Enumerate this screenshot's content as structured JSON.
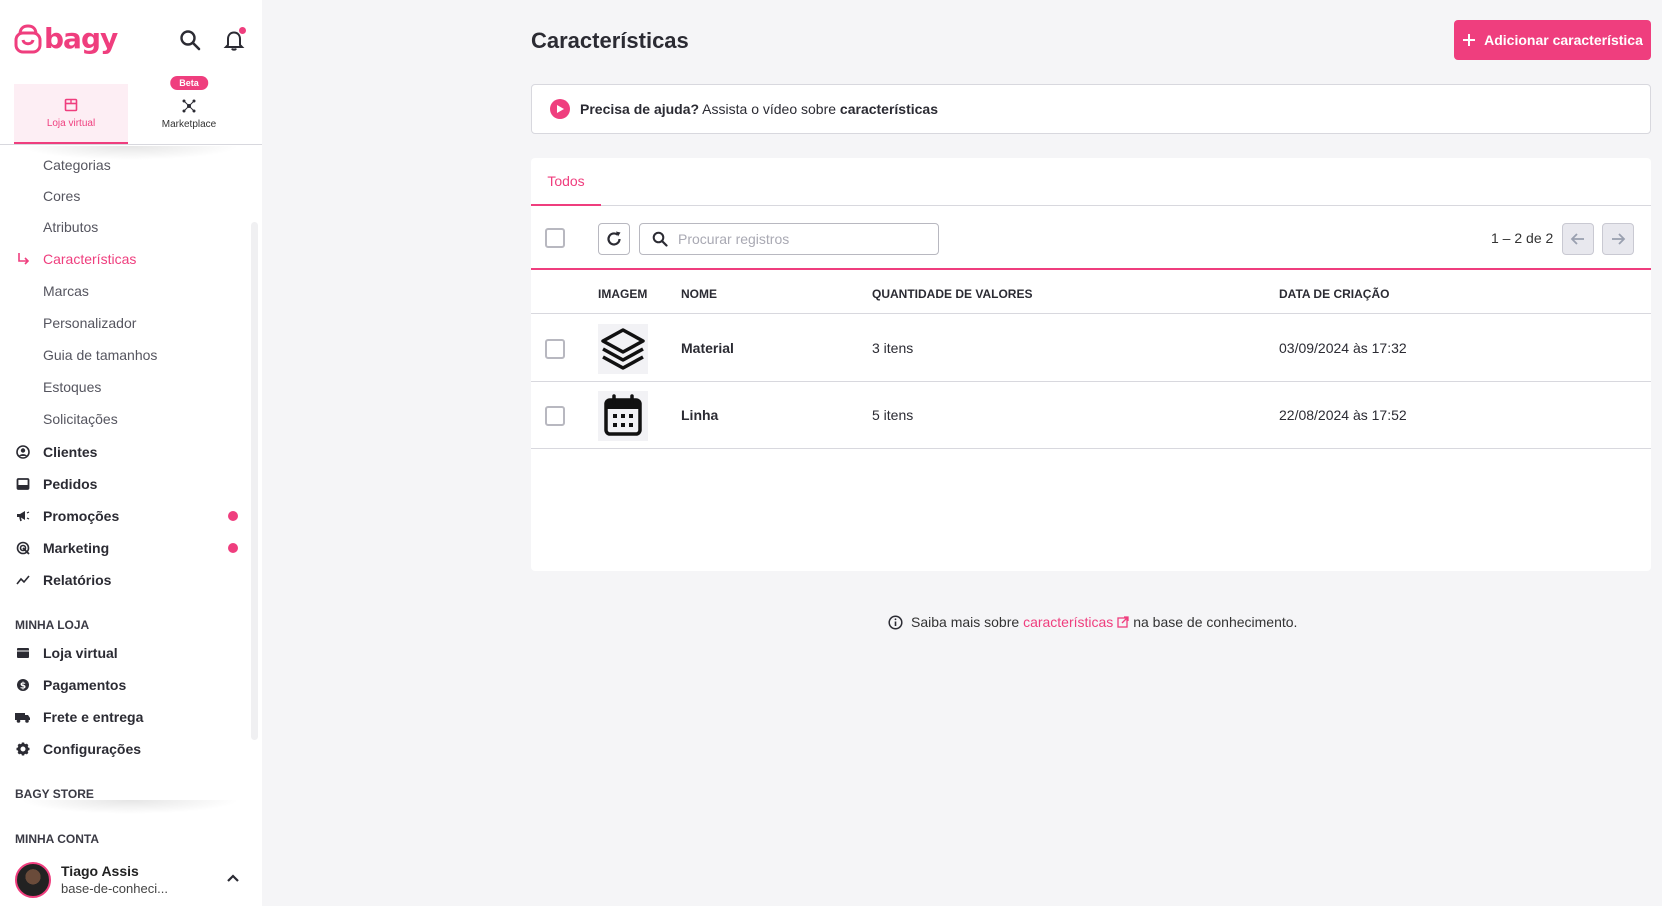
{
  "brand": {
    "name": "bagy",
    "accent": "#ef3e7e"
  },
  "context_tabs": [
    {
      "label": "Loja virtual",
      "icon": "store-icon",
      "active": true
    },
    {
      "label": "Marketplace",
      "icon": "network-icon",
      "badge": "Beta",
      "active": false
    }
  ],
  "nav": {
    "sub_items": [
      "Categorias",
      "Cores",
      "Atributos",
      "Características",
      "Marcas",
      "Personalizador",
      "Guia de tamanhos",
      "Estoques",
      "Solicitações"
    ],
    "current": "Características",
    "main_items": [
      {
        "label": "Clientes",
        "icon": "user-circle-icon"
      },
      {
        "label": "Pedidos",
        "icon": "inbox-icon"
      },
      {
        "label": "Promoções",
        "icon": "megaphone-icon",
        "dot": true
      },
      {
        "label": "Marketing",
        "icon": "target-icon",
        "dot": true
      },
      {
        "label": "Relatórios",
        "icon": "chart-line-icon"
      }
    ],
    "section_store": "MINHA LOJA",
    "store_items": [
      {
        "label": "Loja virtual",
        "icon": "storefront-icon"
      },
      {
        "label": "Pagamentos",
        "icon": "dollar-circle-icon"
      },
      {
        "label": "Frete e entrega",
        "icon": "truck-icon"
      },
      {
        "label": "Configurações",
        "icon": "gear-icon"
      }
    ],
    "section_bagy": "BAGY STORE",
    "section_account": "MINHA CONTA"
  },
  "account": {
    "name": "Tiago Assis",
    "store": "base-de-conheci..."
  },
  "page": {
    "title": "Características",
    "add_button": "Adicionar característica",
    "help": {
      "bold": "Precisa de ajuda?",
      "text": " Assista o vídeo sobre ",
      "topic": "características"
    }
  },
  "table": {
    "tab": "Todos",
    "search_placeholder": "Procurar registros",
    "pagination": "1 – 2 de 2",
    "columns": [
      "IMAGEM",
      "NOME",
      "QUANTIDADE DE VALORES",
      "DATA DE CRIAÇÃO"
    ],
    "rows": [
      {
        "image": "layers-icon",
        "name": "Material",
        "count": "3 itens",
        "created": "03/09/2024 às 17:32"
      },
      {
        "image": "calendar-icon",
        "name": "Linha",
        "count": "5 itens",
        "created": "22/08/2024 às 17:52"
      }
    ]
  },
  "footer_note": {
    "prefix": "Saiba mais sobre ",
    "link": "características",
    "suffix": " na base de conhecimento."
  }
}
